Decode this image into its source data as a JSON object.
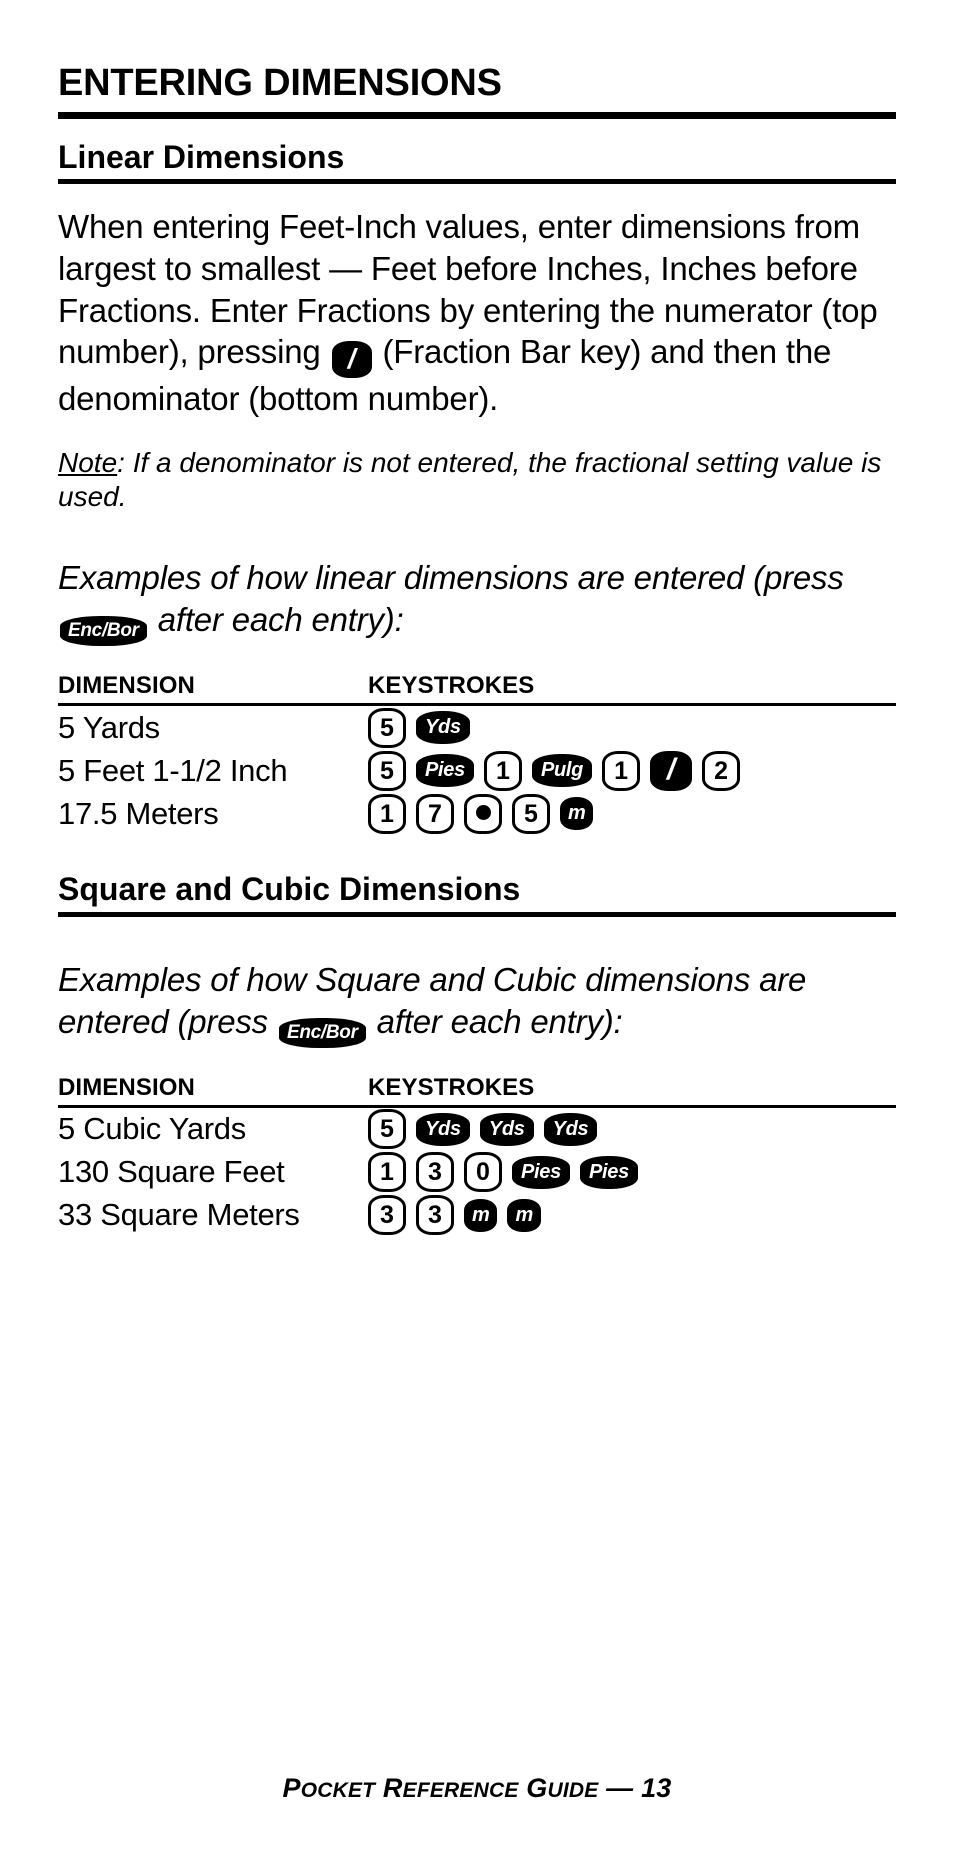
{
  "page": {
    "chapter_title": "ENTERING DIMENSIONS",
    "footer": {
      "word1_cap": "P",
      "word1_rest": "OCKET",
      "word2_cap": "R",
      "word2_rest": "EFERENCE",
      "word3_cap": "G",
      "word3_rest": "UIDE",
      "separator": "—",
      "page_number": "13"
    }
  },
  "linear": {
    "heading": "Linear Dimensions",
    "paragraph_part1": "When entering Feet-Inch values, enter dimensions from largest to smallest — Feet before Inches, Inches before Fractions. Enter Fractions by entering the numerator (top number), pressing",
    "paragraph_part2": "(Fraction Bar key) and then the denominator (bottom number).",
    "note_label": "Note",
    "note_text": ": If a denominator is not entered, the fractional setting value is used.",
    "intro_part1": "Examples of how linear dimensions are entered (press",
    "intro_part2": "after each entry):",
    "table": {
      "headers": [
        "DIMENSION",
        "KEYSTROKES"
      ],
      "rows": [
        {
          "dimension": "5 Yards",
          "keys": [
            {
              "type": "num",
              "label": "5"
            },
            {
              "type": "fn",
              "label": "Yds"
            }
          ]
        },
        {
          "dimension": "5 Feet 1-1/2 Inch",
          "keys": [
            {
              "type": "num",
              "label": "5"
            },
            {
              "type": "fn",
              "label": "Pies"
            },
            {
              "type": "num",
              "label": "1"
            },
            {
              "type": "fn",
              "label": "Pulg"
            },
            {
              "type": "num",
              "label": "1"
            },
            {
              "type": "slash",
              "label": "/"
            },
            {
              "type": "num",
              "label": "2"
            }
          ]
        },
        {
          "dimension": "17.5 Meters",
          "keys": [
            {
              "type": "num",
              "label": "1"
            },
            {
              "type": "num",
              "label": "7"
            },
            {
              "type": "dot",
              "label": "."
            },
            {
              "type": "num",
              "label": "5"
            },
            {
              "type": "fn",
              "label": "m"
            }
          ]
        }
      ]
    }
  },
  "square_cubic": {
    "heading": "Square and Cubic Dimensions",
    "intro_part1": "Examples of how Square and Cubic dimensions are entered (press",
    "intro_part2": "after each entry):",
    "table": {
      "headers": [
        "DIMENSION",
        "KEYSTROKES"
      ],
      "rows": [
        {
          "dimension": "5 Cubic Yards",
          "keys": [
            {
              "type": "num",
              "label": "5"
            },
            {
              "type": "fn",
              "label": "Yds"
            },
            {
              "type": "fn",
              "label": "Yds"
            },
            {
              "type": "fn",
              "label": "Yds"
            }
          ]
        },
        {
          "dimension": "130 Square Feet",
          "keys": [
            {
              "type": "num",
              "label": "1"
            },
            {
              "type": "num",
              "label": "3"
            },
            {
              "type": "num",
              "label": "0"
            },
            {
              "type": "fn",
              "label": "Pies"
            },
            {
              "type": "fn",
              "label": "Pies"
            }
          ]
        },
        {
          "dimension": "33 Square Meters",
          "keys": [
            {
              "type": "num",
              "label": "3"
            },
            {
              "type": "num",
              "label": "3"
            },
            {
              "type": "fn",
              "label": "m"
            },
            {
              "type": "fn",
              "label": "m"
            }
          ]
        }
      ]
    }
  },
  "keys": {
    "enter_bar_label": "Enc/Bor",
    "fraction_bar_label": "/"
  },
  "colors": {
    "ink": "#000000",
    "paper": "#ffffff"
  }
}
